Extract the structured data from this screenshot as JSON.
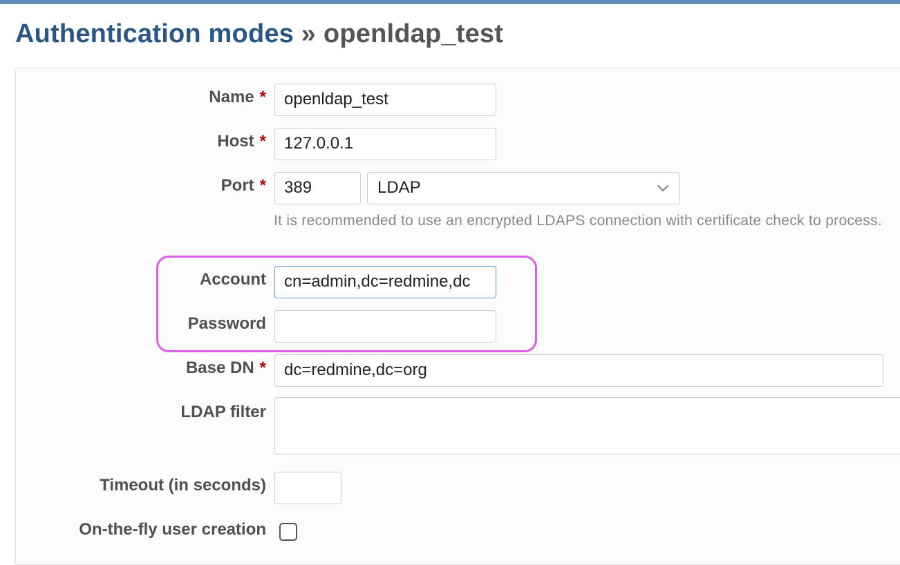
{
  "header": {
    "breadcrumb_link": "Authentication modes",
    "separator": "»",
    "title": "openldap_test"
  },
  "form": {
    "required_mark": "*",
    "name": {
      "label": "Name",
      "value": "openldap_test"
    },
    "host": {
      "label": "Host",
      "value": "127.0.0.1"
    },
    "port": {
      "label": "Port",
      "value": "389",
      "protocol": "LDAP"
    },
    "port_hint": "It is recommended to use an encrypted LDAPS connection with certificate check to process.",
    "account": {
      "label": "Account",
      "value": "cn=admin,dc=redmine,dc"
    },
    "password": {
      "label": "Password",
      "value": ""
    },
    "base_dn": {
      "label": "Base DN",
      "value": "dc=redmine,dc=org"
    },
    "ldap_filter": {
      "label": "LDAP filter",
      "value": ""
    },
    "timeout": {
      "label": "Timeout (in seconds)",
      "value": ""
    },
    "onthefly": {
      "label": "On-the-fly user creation",
      "checked": false
    }
  },
  "colors": {
    "topbar": "#628db6",
    "link": "#2a5685",
    "required": "#bb0000",
    "highlight": "#e05ce8",
    "focus_border": "#5ea0d8"
  },
  "icons": {
    "select_arrow": "chevron-down-icon"
  }
}
